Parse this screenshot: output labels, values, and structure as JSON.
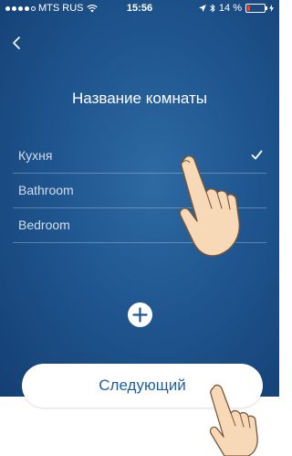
{
  "status_bar": {
    "carrier": "MTS RUS",
    "time": "15:56",
    "battery": "14 %",
    "battery_level": 0.14
  },
  "page": {
    "title": "Название комнаты"
  },
  "rooms": [
    {
      "label": "Кухня",
      "selected": true
    },
    {
      "label": "Bathroom",
      "selected": false
    },
    {
      "label": "Bedroom",
      "selected": false
    }
  ],
  "actions": {
    "next_label": "Следующий"
  },
  "icons": {
    "back": "chevron-left-icon",
    "check": "checkmark-icon",
    "add": "plus-icon",
    "gesture": "tap-hand-icon"
  },
  "colors": {
    "background": "#1f568f",
    "button_text": "#1e5f9e",
    "battery_low": "#ff3b30"
  }
}
